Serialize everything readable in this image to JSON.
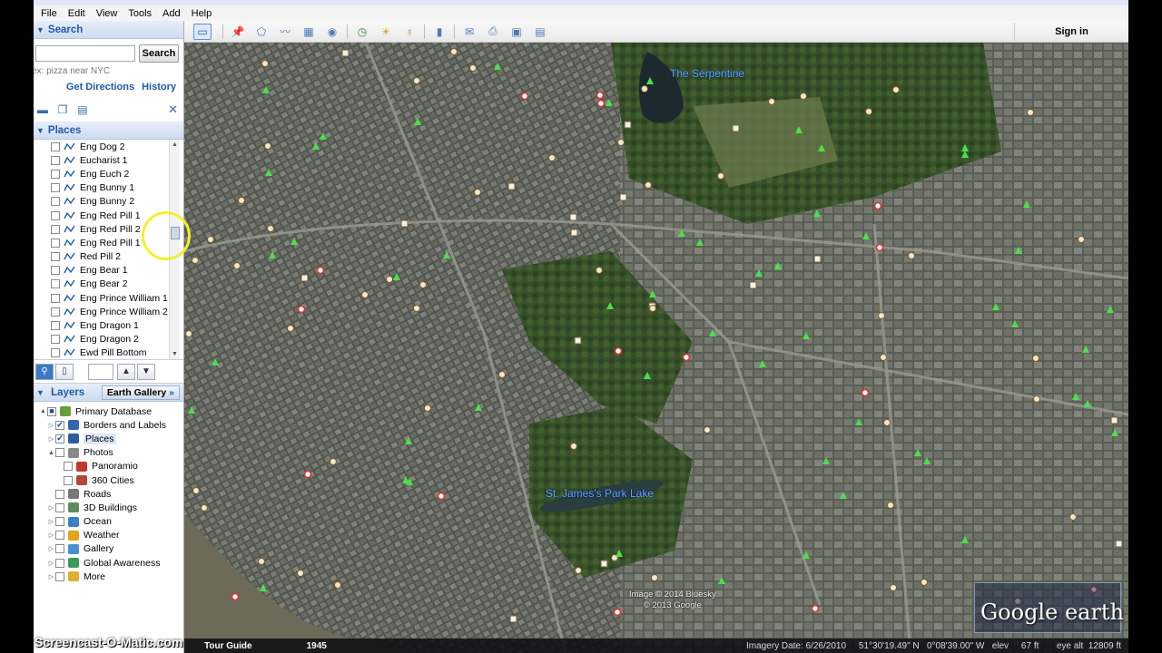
{
  "menu": [
    "File",
    "Edit",
    "View",
    "Tools",
    "Add",
    "Help"
  ],
  "search": {
    "title": "Search",
    "placeholder": "",
    "button": "Search",
    "hint": "ex: pizza near NYC",
    "links": [
      "Get Directions",
      "History"
    ]
  },
  "places": {
    "title": "Places",
    "items": [
      "Eng Dog 2",
      "Eucharist 1",
      "Eng Euch 2",
      "Eng Bunny 1",
      "Eng Bunny 2",
      "Eng Red Pill 1",
      "Eng Red Pill 2",
      "Eng Red Pill 1",
      "Red Pill 2",
      "Eng Bear 1",
      "Eng  Bear 2",
      "Eng Prince William 1",
      "Eng Prince William 2",
      "Eng Dragon 1",
      "Eng Dragon 2",
      "Ewd Pill Bottom"
    ]
  },
  "layers": {
    "title": "Layers",
    "gallery": "Earth Gallery",
    "gallery_arrow": "»",
    "items": [
      {
        "label": "Primary Database",
        "level": 0,
        "expand": "▲",
        "checked": "■",
        "color": "#6b9c3a"
      },
      {
        "label": "Borders and Labels",
        "level": 1,
        "expand": "▷",
        "checked": "✔",
        "color": "#3564b0"
      },
      {
        "label": "Places",
        "level": 1,
        "expand": "▷",
        "checked": "✔",
        "color": "#2d5d9f",
        "selected": true
      },
      {
        "label": "Photos",
        "level": 1,
        "expand": "▲",
        "checked": "",
        "color": "#888888"
      },
      {
        "label": "Panoramio",
        "level": 2,
        "expand": "",
        "checked": "",
        "color": "#c0392b"
      },
      {
        "label": "360 Cities",
        "level": 2,
        "expand": "",
        "checked": "",
        "color": "#b0483a"
      },
      {
        "label": "Roads",
        "level": 1,
        "expand": "",
        "checked": "",
        "color": "#777777"
      },
      {
        "label": "3D Buildings",
        "level": 1,
        "expand": "▷",
        "checked": "",
        "color": "#5d8a5a"
      },
      {
        "label": "Ocean",
        "level": 1,
        "expand": "▷",
        "checked": "",
        "color": "#3a80c8"
      },
      {
        "label": "Weather",
        "level": 1,
        "expand": "▷",
        "checked": "",
        "color": "#e6a21c"
      },
      {
        "label": "Gallery",
        "level": 1,
        "expand": "▷",
        "checked": "",
        "color": "#4a90d0"
      },
      {
        "label": "Global Awareness",
        "level": 1,
        "expand": "▷",
        "checked": "",
        "color": "#3a9a5a"
      },
      {
        "label": "More",
        "level": 1,
        "expand": "▷",
        "checked": "",
        "color": "#e0b030"
      }
    ]
  },
  "toolbar": {
    "sign_in": "Sign in",
    "icons": [
      "sidebar-toggle-icon",
      "placemark-icon",
      "polygon-icon",
      "path-icon",
      "image-overlay-icon",
      "record-tour-icon",
      "historical-imagery-icon",
      "sunlight-icon",
      "planets-icon",
      "ruler-icon",
      "email-icon",
      "print-icon",
      "save-image-icon",
      "maps-icon"
    ]
  },
  "map": {
    "labels": [
      "The Serpentine",
      "St. James's Park Lake"
    ],
    "copyright_line1": "Image © 2014 Bluesky",
    "copyright_line2": "© 2013 Google",
    "logo": "Google earth",
    "tour_guide": "Tour Guide",
    "year": "1945",
    "status_meta": "Imagery Date: 6/26/2010     51°30'19.49\" N   0°08'39.00\" W   elev     67 ft       eye alt  12809 ft"
  },
  "watermark": "Screencast-O-Matic.com"
}
